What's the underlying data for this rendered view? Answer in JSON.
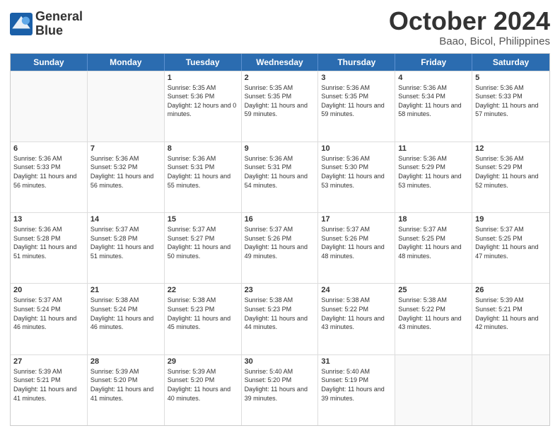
{
  "logo": {
    "line1": "General",
    "line2": "Blue"
  },
  "title": "October 2024",
  "subtitle": "Baao, Bicol, Philippines",
  "headers": [
    "Sunday",
    "Monday",
    "Tuesday",
    "Wednesday",
    "Thursday",
    "Friday",
    "Saturday"
  ],
  "weeks": [
    [
      {
        "date": "",
        "sunrise": "",
        "sunset": "",
        "daylight": "",
        "empty": true
      },
      {
        "date": "",
        "sunrise": "",
        "sunset": "",
        "daylight": "",
        "empty": true
      },
      {
        "date": "1",
        "sunrise": "Sunrise: 5:35 AM",
        "sunset": "Sunset: 5:36 PM",
        "daylight": "Daylight: 12 hours and 0 minutes."
      },
      {
        "date": "2",
        "sunrise": "Sunrise: 5:35 AM",
        "sunset": "Sunset: 5:35 PM",
        "daylight": "Daylight: 11 hours and 59 minutes."
      },
      {
        "date": "3",
        "sunrise": "Sunrise: 5:36 AM",
        "sunset": "Sunset: 5:35 PM",
        "daylight": "Daylight: 11 hours and 59 minutes."
      },
      {
        "date": "4",
        "sunrise": "Sunrise: 5:36 AM",
        "sunset": "Sunset: 5:34 PM",
        "daylight": "Daylight: 11 hours and 58 minutes."
      },
      {
        "date": "5",
        "sunrise": "Sunrise: 5:36 AM",
        "sunset": "Sunset: 5:33 PM",
        "daylight": "Daylight: 11 hours and 57 minutes."
      }
    ],
    [
      {
        "date": "6",
        "sunrise": "Sunrise: 5:36 AM",
        "sunset": "Sunset: 5:33 PM",
        "daylight": "Daylight: 11 hours and 56 minutes."
      },
      {
        "date": "7",
        "sunrise": "Sunrise: 5:36 AM",
        "sunset": "Sunset: 5:32 PM",
        "daylight": "Daylight: 11 hours and 56 minutes."
      },
      {
        "date": "8",
        "sunrise": "Sunrise: 5:36 AM",
        "sunset": "Sunset: 5:31 PM",
        "daylight": "Daylight: 11 hours and 55 minutes."
      },
      {
        "date": "9",
        "sunrise": "Sunrise: 5:36 AM",
        "sunset": "Sunset: 5:31 PM",
        "daylight": "Daylight: 11 hours and 54 minutes."
      },
      {
        "date": "10",
        "sunrise": "Sunrise: 5:36 AM",
        "sunset": "Sunset: 5:30 PM",
        "daylight": "Daylight: 11 hours and 53 minutes."
      },
      {
        "date": "11",
        "sunrise": "Sunrise: 5:36 AM",
        "sunset": "Sunset: 5:29 PM",
        "daylight": "Daylight: 11 hours and 53 minutes."
      },
      {
        "date": "12",
        "sunrise": "Sunrise: 5:36 AM",
        "sunset": "Sunset: 5:29 PM",
        "daylight": "Daylight: 11 hours and 52 minutes."
      }
    ],
    [
      {
        "date": "13",
        "sunrise": "Sunrise: 5:36 AM",
        "sunset": "Sunset: 5:28 PM",
        "daylight": "Daylight: 11 hours and 51 minutes."
      },
      {
        "date": "14",
        "sunrise": "Sunrise: 5:37 AM",
        "sunset": "Sunset: 5:28 PM",
        "daylight": "Daylight: 11 hours and 51 minutes."
      },
      {
        "date": "15",
        "sunrise": "Sunrise: 5:37 AM",
        "sunset": "Sunset: 5:27 PM",
        "daylight": "Daylight: 11 hours and 50 minutes."
      },
      {
        "date": "16",
        "sunrise": "Sunrise: 5:37 AM",
        "sunset": "Sunset: 5:26 PM",
        "daylight": "Daylight: 11 hours and 49 minutes."
      },
      {
        "date": "17",
        "sunrise": "Sunrise: 5:37 AM",
        "sunset": "Sunset: 5:26 PM",
        "daylight": "Daylight: 11 hours and 48 minutes."
      },
      {
        "date": "18",
        "sunrise": "Sunrise: 5:37 AM",
        "sunset": "Sunset: 5:25 PM",
        "daylight": "Daylight: 11 hours and 48 minutes."
      },
      {
        "date": "19",
        "sunrise": "Sunrise: 5:37 AM",
        "sunset": "Sunset: 5:25 PM",
        "daylight": "Daylight: 11 hours and 47 minutes."
      }
    ],
    [
      {
        "date": "20",
        "sunrise": "Sunrise: 5:37 AM",
        "sunset": "Sunset: 5:24 PM",
        "daylight": "Daylight: 11 hours and 46 minutes."
      },
      {
        "date": "21",
        "sunrise": "Sunrise: 5:38 AM",
        "sunset": "Sunset: 5:24 PM",
        "daylight": "Daylight: 11 hours and 46 minutes."
      },
      {
        "date": "22",
        "sunrise": "Sunrise: 5:38 AM",
        "sunset": "Sunset: 5:23 PM",
        "daylight": "Daylight: 11 hours and 45 minutes."
      },
      {
        "date": "23",
        "sunrise": "Sunrise: 5:38 AM",
        "sunset": "Sunset: 5:23 PM",
        "daylight": "Daylight: 11 hours and 44 minutes."
      },
      {
        "date": "24",
        "sunrise": "Sunrise: 5:38 AM",
        "sunset": "Sunset: 5:22 PM",
        "daylight": "Daylight: 11 hours and 43 minutes."
      },
      {
        "date": "25",
        "sunrise": "Sunrise: 5:38 AM",
        "sunset": "Sunset: 5:22 PM",
        "daylight": "Daylight: 11 hours and 43 minutes."
      },
      {
        "date": "26",
        "sunrise": "Sunrise: 5:39 AM",
        "sunset": "Sunset: 5:21 PM",
        "daylight": "Daylight: 11 hours and 42 minutes."
      }
    ],
    [
      {
        "date": "27",
        "sunrise": "Sunrise: 5:39 AM",
        "sunset": "Sunset: 5:21 PM",
        "daylight": "Daylight: 11 hours and 41 minutes."
      },
      {
        "date": "28",
        "sunrise": "Sunrise: 5:39 AM",
        "sunset": "Sunset: 5:20 PM",
        "daylight": "Daylight: 11 hours and 41 minutes."
      },
      {
        "date": "29",
        "sunrise": "Sunrise: 5:39 AM",
        "sunset": "Sunset: 5:20 PM",
        "daylight": "Daylight: 11 hours and 40 minutes."
      },
      {
        "date": "30",
        "sunrise": "Sunrise: 5:40 AM",
        "sunset": "Sunset: 5:20 PM",
        "daylight": "Daylight: 11 hours and 39 minutes."
      },
      {
        "date": "31",
        "sunrise": "Sunrise: 5:40 AM",
        "sunset": "Sunset: 5:19 PM",
        "daylight": "Daylight: 11 hours and 39 minutes."
      },
      {
        "date": "",
        "sunrise": "",
        "sunset": "",
        "daylight": "",
        "empty": true
      },
      {
        "date": "",
        "sunrise": "",
        "sunset": "",
        "daylight": "",
        "empty": true
      }
    ]
  ]
}
